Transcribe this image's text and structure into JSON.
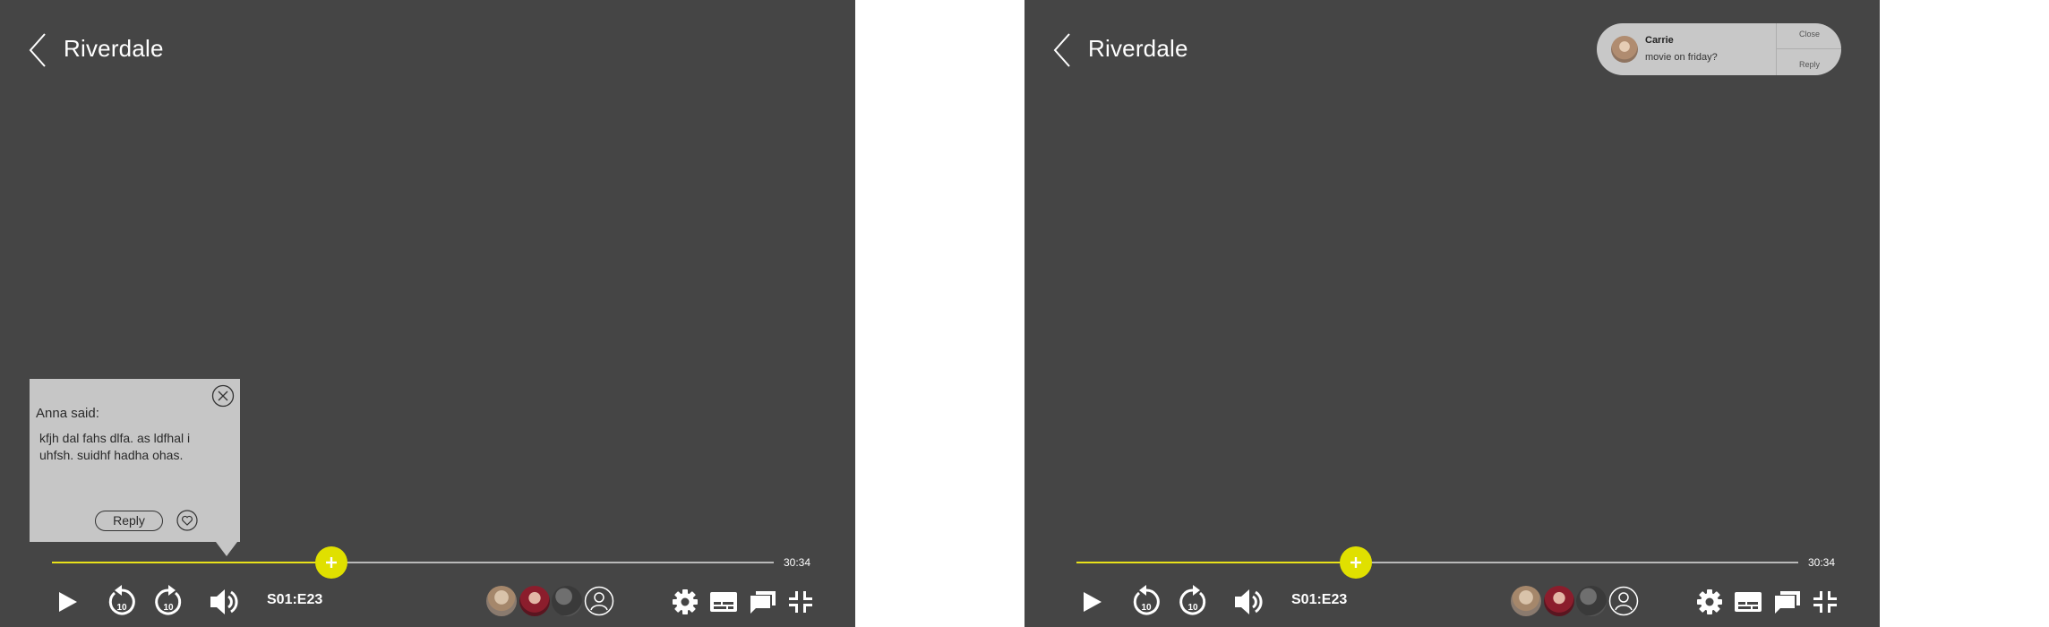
{
  "screens": [
    {
      "title": "Riverdale",
      "duration": "30:34",
      "progress_fraction": 0.387,
      "episode": "S01:E23",
      "comment_popup": {
        "author": "Anna said:",
        "message": "kfjh dal fahs dlfa. as ldfhal i uhfsh. suidhf hadha  ohas.",
        "reply_label": "Reply"
      }
    },
    {
      "title": "Riverdale",
      "duration": "30:34",
      "progress_fraction": 0.387,
      "episode": "S01:E23",
      "notification": {
        "name": "Carrie",
        "message": "movie on friday?",
        "close_label": "Close",
        "reply_label": "Reply"
      }
    }
  ],
  "colors": {
    "background": "#454545",
    "accent": "#e0e000",
    "popup": "#c6c6c6"
  },
  "icons": [
    "back-arrow-icon",
    "play-icon",
    "rewind-10-icon",
    "forward-10-icon",
    "volume-icon",
    "add-friend-icon",
    "settings-gear-icon",
    "subtitles-icon",
    "chat-icon",
    "exit-fullscreen-icon",
    "close-circle-icon",
    "heart-icon",
    "plus-icon"
  ]
}
